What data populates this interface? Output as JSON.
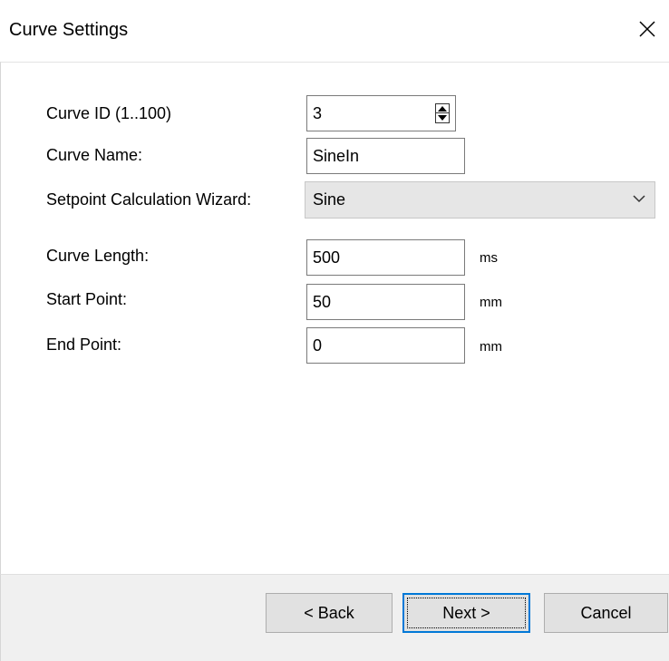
{
  "dialog": {
    "title": "Curve Settings"
  },
  "form": {
    "curve_id": {
      "label": "Curve ID (1..100)",
      "value": "3"
    },
    "curve_name": {
      "label": "Curve Name:",
      "value": "SineIn"
    },
    "wizard": {
      "label": "Setpoint Calculation Wizard:",
      "selected": "Sine"
    },
    "curve_length": {
      "label": "Curve Length:",
      "value": "500",
      "unit": "ms"
    },
    "start_point": {
      "label": "Start Point:",
      "value": "50",
      "unit": "mm"
    },
    "end_point": {
      "label": "End Point:",
      "value": "0",
      "unit": "mm"
    }
  },
  "buttons": {
    "back": "< Back",
    "next": "Next >",
    "cancel": "Cancel"
  },
  "icons": {
    "close": "close-icon",
    "spin_up": "arrow-up-icon",
    "spin_down": "arrow-down-icon",
    "dropdown": "chevron-down-icon"
  },
  "colors": {
    "default_button_border": "#0078d7",
    "footer_bg": "#f0f0f0"
  }
}
